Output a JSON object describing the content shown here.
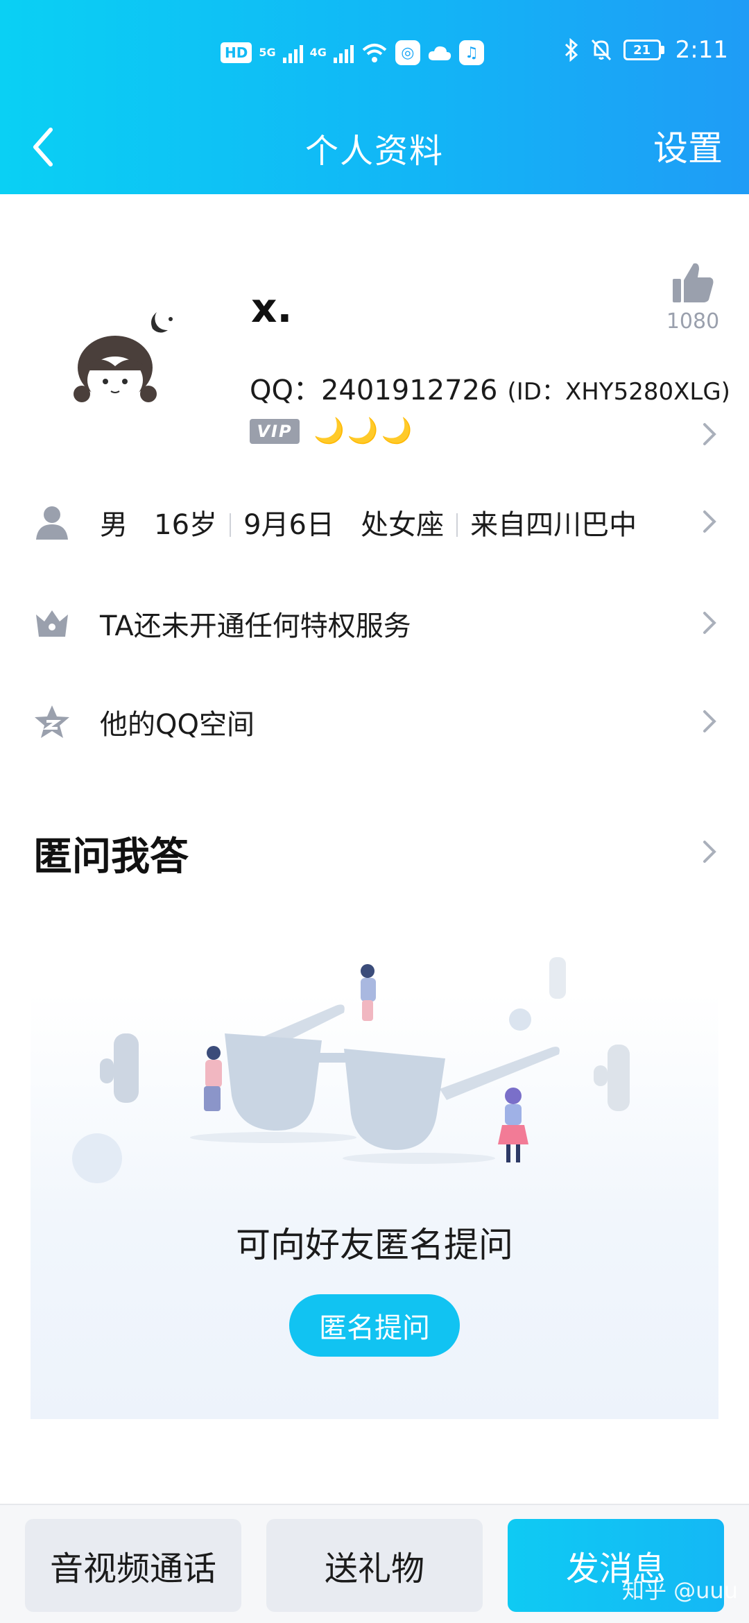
{
  "status_bar": {
    "hd_label": "HD",
    "net_5g": "5G",
    "net_4g": "4G",
    "battery_level": "21",
    "time": "2:11"
  },
  "title_bar": {
    "title": "个人资料",
    "settings_label": "设置"
  },
  "profile": {
    "nickname": "x.",
    "qq_line": "QQ：2401912726",
    "id_line": "(ID：XHY5280XLG)",
    "vip_label": "VIP",
    "level_moons": [
      "🌙",
      "🌙",
      "🌙"
    ],
    "like_count": "1080"
  },
  "info_row": {
    "gender": "男",
    "age": "16岁",
    "birthday": "9月6日",
    "zodiac": "处女座",
    "hometown": "来自四川巴中"
  },
  "privilege_row": {
    "label": "TA还未开通任何特权服务"
  },
  "qzone_row": {
    "label": "他的QQ空间"
  },
  "anon_section": {
    "title": "匿问我答",
    "prompt": "可向好友匿名提问",
    "button_label": "匿名提问"
  },
  "bottom_bar": {
    "call_label": "音视频通话",
    "gift_label": "送礼物",
    "message_label": "发消息"
  },
  "watermark": "知乎 @uuu",
  "colors": {
    "accent": "#12b6f6",
    "button_cyan": "#11c3f2",
    "icon_gray": "#9aa0ad"
  }
}
